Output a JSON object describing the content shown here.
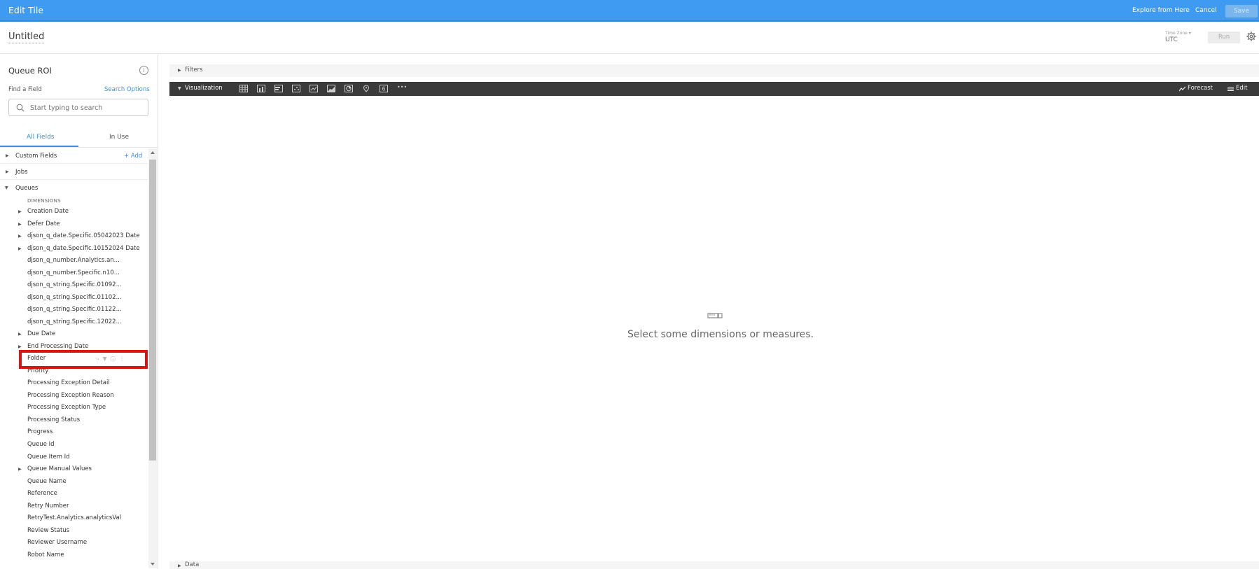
{
  "header": {
    "title": "Edit Tile",
    "explore_link": "Explore from Here",
    "cancel": "Cancel",
    "save": "Save"
  },
  "title_row": {
    "tile_name": "Untitled",
    "timezone_label": "Time Zone ▾",
    "timezone_value": "UTC",
    "run": "Run"
  },
  "left_panel": {
    "explore_title": "Queue ROI",
    "info_glyph": "i",
    "find_label": "Find a Field",
    "search_options": "Search Options",
    "search_placeholder": "Start typing to search",
    "tabs": [
      "All Fields",
      "In Use"
    ],
    "groups": {
      "custom_fields": "Custom Fields",
      "add": "+ Add",
      "jobs": "Jobs",
      "queues": "Queues"
    },
    "dimensions_header": "DIMENSIONS",
    "fields": [
      "Creation Date",
      "Defer Date",
      "djson_q_date.Specific.05042023 Date",
      "djson_q_date.Specific.10152024 Date",
      "djson_q_number.Analytics.an...",
      "djson_q_number.Specific.n10...",
      "djson_q_string.Specific.01092...",
      "djson_q_string.Specific.01102...",
      "djson_q_string.Specific.01122...",
      "djson_q_string.Specific.12022...",
      "Due Date",
      "End Processing Date",
      "Folder",
      "Priority",
      "Processing Exception Detail",
      "Processing Exception Reason",
      "Processing Exception Type",
      "Processing Status",
      "Progress",
      "Queue Id",
      "Queue Item Id",
      "Queue Manual Values",
      "Queue Name",
      "Reference",
      "Retry Number",
      "RetryTest.Analytics.analyticsVal",
      "Review Status",
      "Reviewer Username",
      "Robot Name"
    ]
  },
  "main": {
    "filters_label": "Filters",
    "visualization_label": "Visualization",
    "viz_more": "•••",
    "forecast": "Forecast",
    "edit": "Edit",
    "empty_message": "Select some dimensions or measures.",
    "data_label": "Data"
  },
  "colors": {
    "header_blue": "#3f9bf1",
    "accent_blue": "#3a8ee6",
    "viz_bar": "#3a3a3a",
    "highlight_red": "#d81515"
  },
  "icons": {
    "search": "search-icon",
    "settings": "gear-icon",
    "info": "info-icon",
    "viz_types": [
      "table-icon",
      "column-chart-icon",
      "bar-chart-icon",
      "scatter-icon",
      "line-chart-icon",
      "area-chart-icon",
      "pie-chart-icon",
      "map-pin-icon",
      "single-value-icon",
      "more-icon"
    ]
  }
}
